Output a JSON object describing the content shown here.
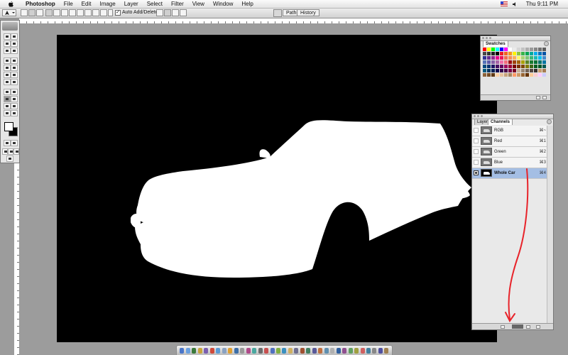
{
  "menubar": {
    "app_name": "Photoshop",
    "items": [
      "File",
      "Edit",
      "Image",
      "Layer",
      "Select",
      "Filter",
      "View",
      "Window",
      "Help"
    ],
    "clock": "Thu 9:11 PM"
  },
  "options_bar": {
    "auto_add_delete_label": "Auto Add/Delete",
    "auto_add_delete_checked": true,
    "palette_well_tabs": [
      "Paths",
      "History"
    ]
  },
  "swatches_palette": {
    "tab": "Swatches",
    "colors": [
      "#ff0000",
      "#ffff00",
      "#00ff00",
      "#00ffff",
      "#0000ff",
      "#ff00ff",
      "#ffffff",
      "#ebebeb",
      "#d6d6d6",
      "#c2c2c2",
      "#adadad",
      "#999999",
      "#858585",
      "#707070",
      "#5c5c5c",
      "#474747",
      "#333333",
      "#1f1f1f",
      "#000000",
      "#ed1c24",
      "#f26522",
      "#f7941d",
      "#fff200",
      "#8dc63f",
      "#39b54a",
      "#00a651",
      "#00a99d",
      "#00aeef",
      "#0072bc",
      "#0054a6",
      "#2e3192",
      "#662d91",
      "#92278f",
      "#ec008c",
      "#ed145b",
      "#f26c4f",
      "#f68e56",
      "#fbaf5d",
      "#fff568",
      "#acd372",
      "#7cc576",
      "#3bb878",
      "#1abbb4",
      "#00bff3",
      "#448ccb",
      "#5574b9",
      "#605ca8",
      "#8560a8",
      "#a864a8",
      "#f06eaa",
      "#f26d7d",
      "#9e0b0f",
      "#a0410d",
      "#a3620a",
      "#aba000",
      "#598527",
      "#197b30",
      "#007236",
      "#00746b",
      "#0076a3",
      "#004a80",
      "#003471",
      "#1b1464",
      "#440e62",
      "#630460",
      "#9e005d",
      "#9e0039",
      "#790000",
      "#7b2e00",
      "#7d4900",
      "#827b00",
      "#406618",
      "#005e20",
      "#005826",
      "#005952",
      "#005b7f",
      "#003663",
      "#002157",
      "#0d004c",
      "#32004b",
      "#4b0049",
      "#7b0046",
      "#7a0026",
      "#c7b299",
      "#998675",
      "#736357",
      "#534741",
      "#37302d",
      "#c69c6d",
      "#a67c52",
      "#8c6239",
      "#754c24",
      "#603913",
      "#fcd3a6",
      "#e8c39e",
      "#c8a27a",
      "#a8865f",
      "#ff9966",
      "#cc9966",
      "#996633",
      "#663300",
      "#ffcc99",
      "#ffcccc",
      "#ffccff",
      "#ccccff"
    ]
  },
  "channels_palette": {
    "tabs": [
      "Layers",
      "Channels"
    ],
    "active_tab": "Channels",
    "channels": [
      {
        "name": "RGB",
        "shortcut": "⌘~",
        "visible": false,
        "selected": false
      },
      {
        "name": "Red",
        "shortcut": "⌘1",
        "visible": false,
        "selected": false
      },
      {
        "name": "Green",
        "shortcut": "⌘2",
        "visible": false,
        "selected": false
      },
      {
        "name": "Blue",
        "shortcut": "⌘3",
        "visible": false,
        "selected": false
      },
      {
        "name": "Whole Car",
        "shortcut": "⌘4",
        "visible": true,
        "selected": true
      }
    ]
  },
  "document": {
    "content": "car-silhouette-mask",
    "background_color": "#000000",
    "foreground_color": "#ffffff"
  },
  "annotation": {
    "color": "#e8232a"
  },
  "colors": {
    "selected_row": "#a4bee4",
    "desktop": "#9c9c9c"
  }
}
